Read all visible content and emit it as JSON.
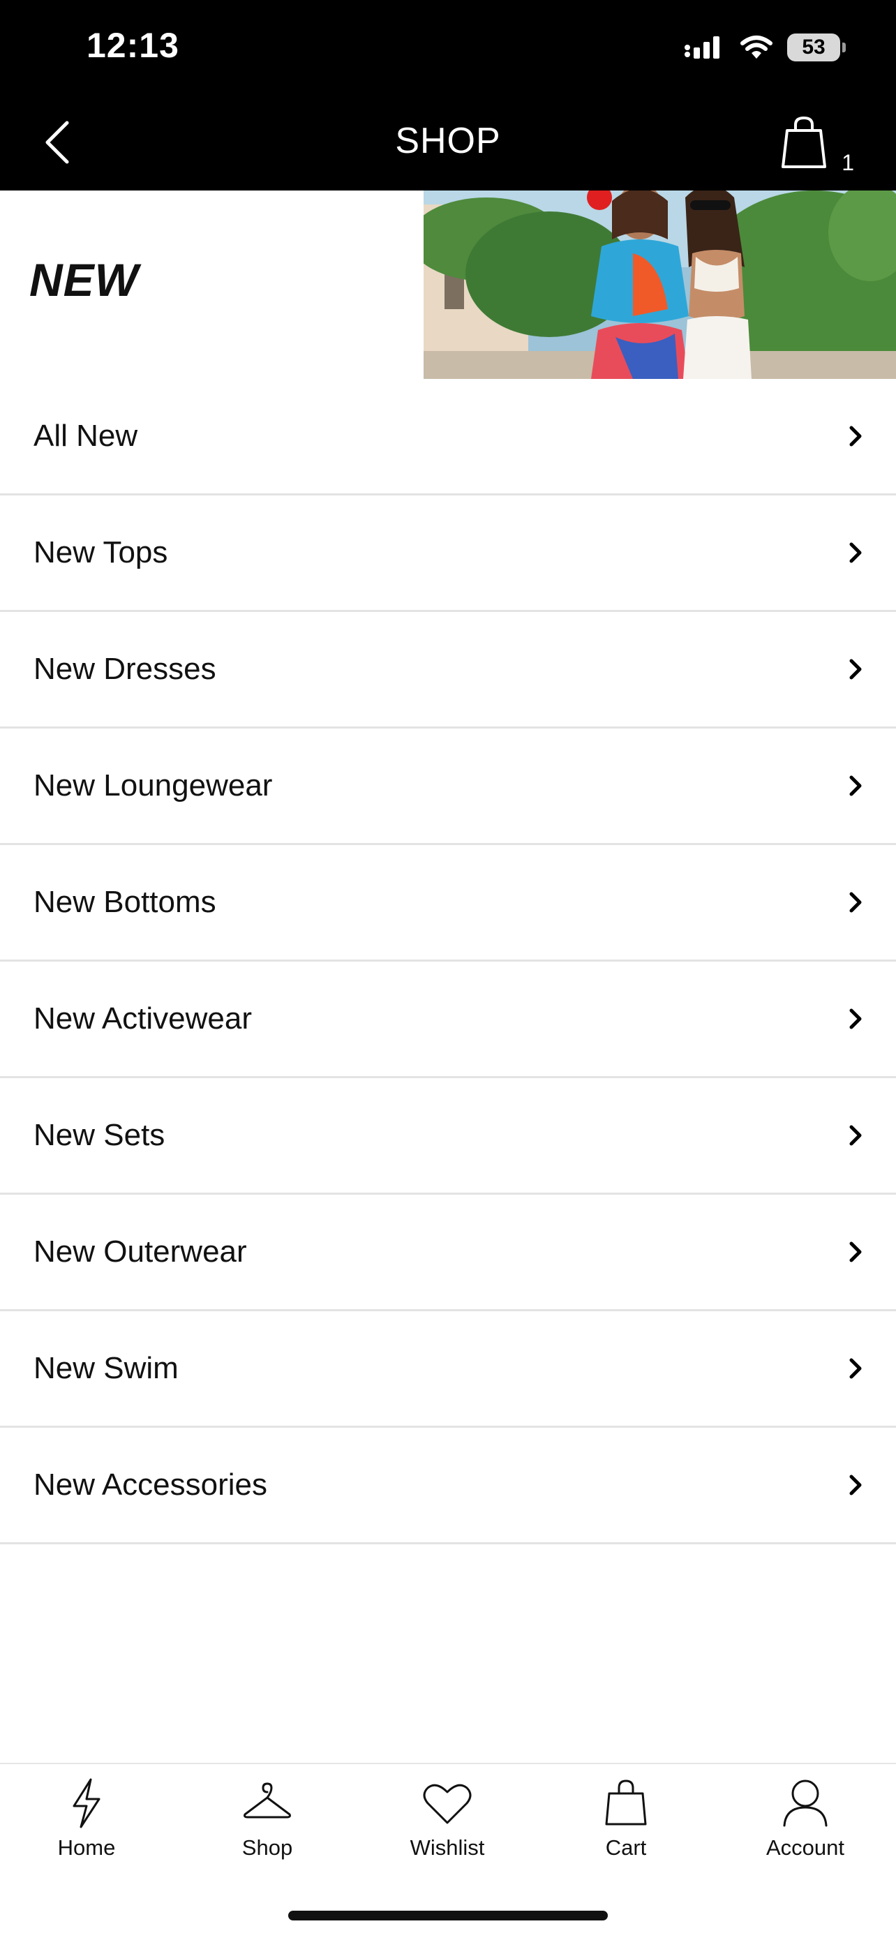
{
  "status_bar": {
    "time": "12:13",
    "battery": "53"
  },
  "header": {
    "title": "SHOP",
    "cart_count": "1"
  },
  "banner": {
    "title": "NEW"
  },
  "categories": [
    {
      "label": "All New"
    },
    {
      "label": "New Tops"
    },
    {
      "label": "New Dresses"
    },
    {
      "label": "New Loungewear"
    },
    {
      "label": "New Bottoms"
    },
    {
      "label": "New Activewear"
    },
    {
      "label": "New Sets"
    },
    {
      "label": "New Outerwear"
    },
    {
      "label": "New Swim"
    },
    {
      "label": "New Accessories"
    }
  ],
  "tab_bar": {
    "tabs": [
      {
        "label": "Home",
        "icon": "lightning-icon"
      },
      {
        "label": "Shop",
        "icon": "hanger-icon"
      },
      {
        "label": "Wishlist",
        "icon": "heart-icon"
      },
      {
        "label": "Cart",
        "icon": "shopping-bag-icon"
      },
      {
        "label": "Account",
        "icon": "user-icon"
      }
    ]
  }
}
